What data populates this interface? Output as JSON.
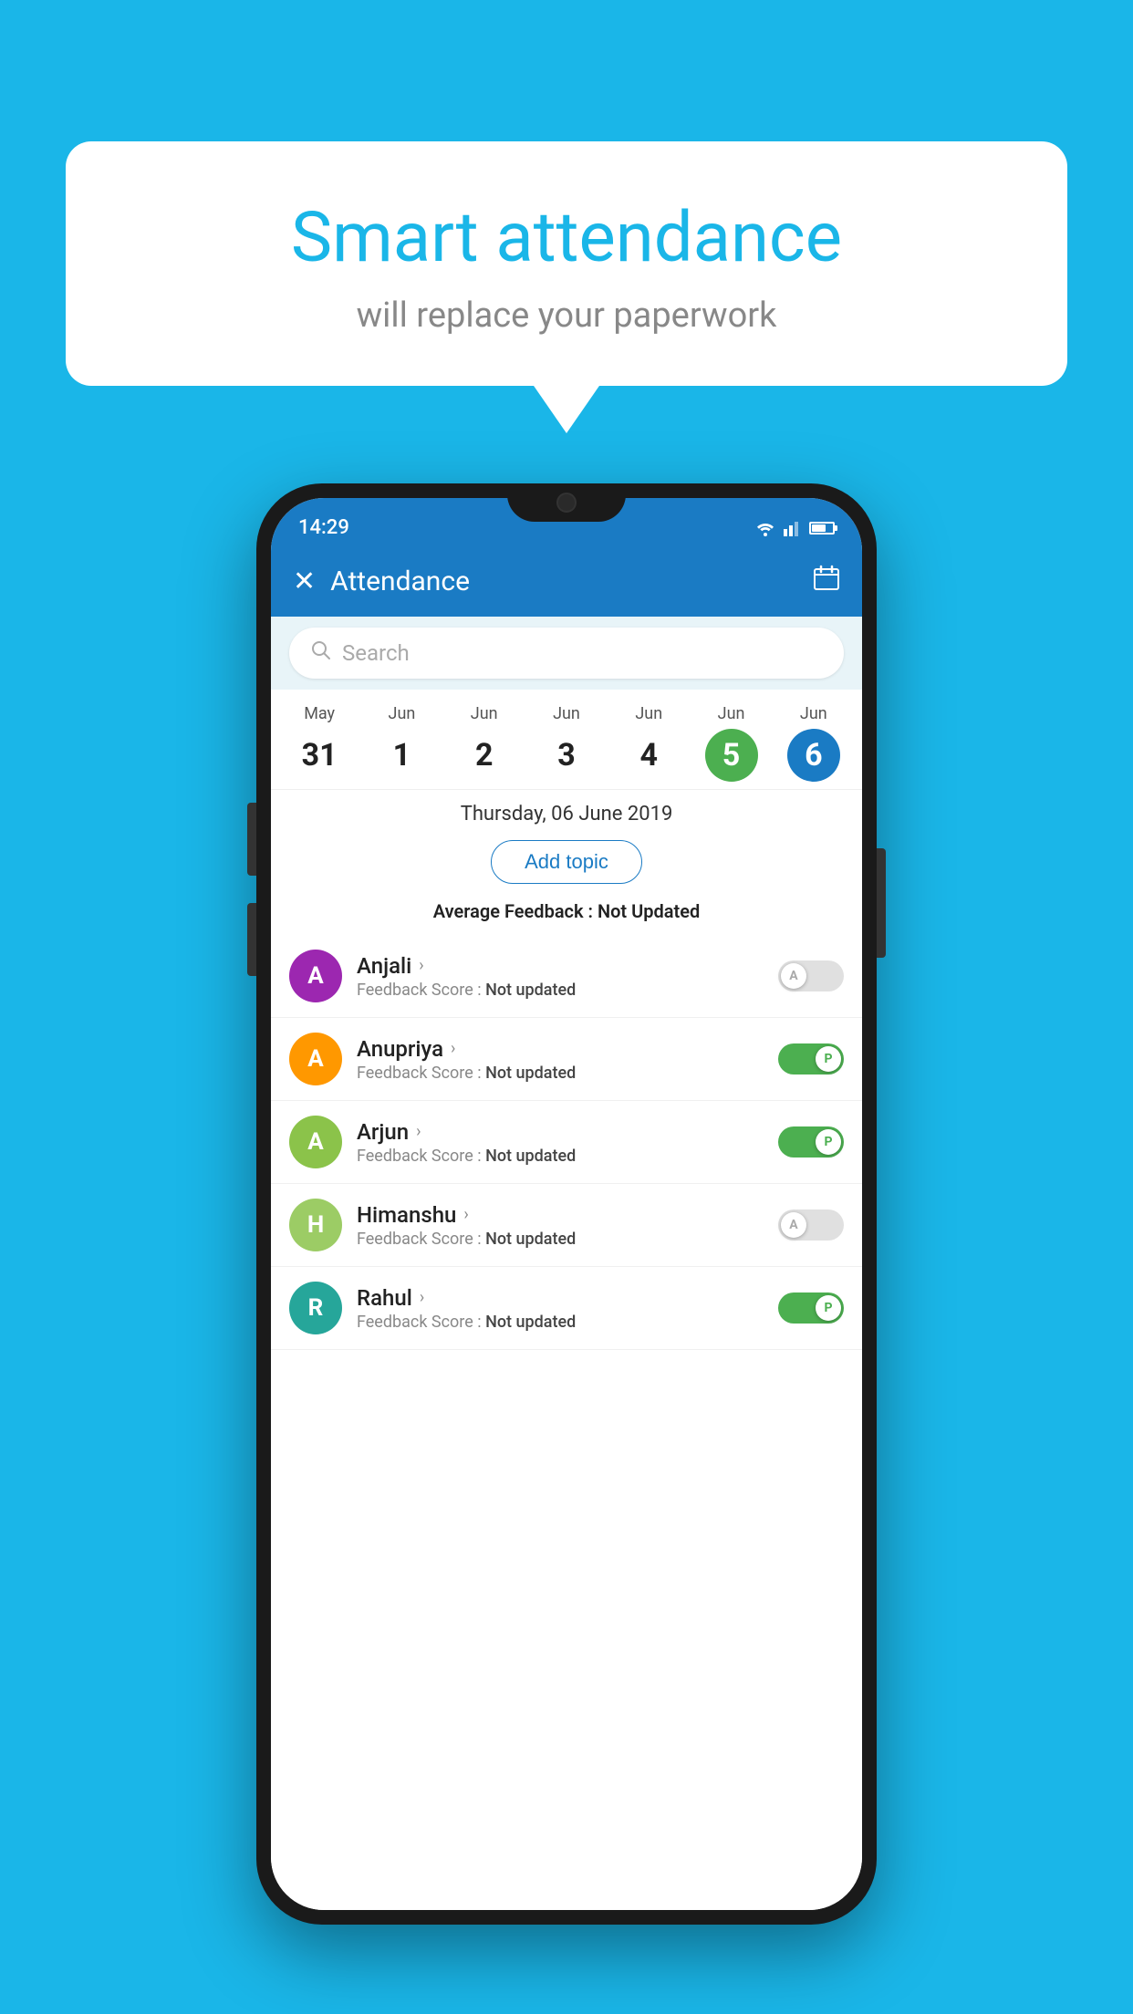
{
  "background_color": "#1ab6e8",
  "speech_bubble": {
    "title": "Smart attendance",
    "subtitle": "will replace your paperwork"
  },
  "status_bar": {
    "time": "14:29",
    "icons": [
      "wifi",
      "signal",
      "battery"
    ]
  },
  "app_bar": {
    "title": "Attendance",
    "close_label": "×",
    "calendar_icon": "📅"
  },
  "search": {
    "placeholder": "Search"
  },
  "calendar": {
    "days": [
      {
        "month": "May",
        "date": "31",
        "state": "normal"
      },
      {
        "month": "Jun",
        "date": "1",
        "state": "normal"
      },
      {
        "month": "Jun",
        "date": "2",
        "state": "normal"
      },
      {
        "month": "Jun",
        "date": "3",
        "state": "normal"
      },
      {
        "month": "Jun",
        "date": "4",
        "state": "normal"
      },
      {
        "month": "Jun",
        "date": "5",
        "state": "today"
      },
      {
        "month": "Jun",
        "date": "6",
        "state": "selected"
      }
    ],
    "selected_date_label": "Thursday, 06 June 2019"
  },
  "add_topic_label": "Add topic",
  "avg_feedback_label": "Average Feedback :",
  "avg_feedback_value": "Not Updated",
  "students": [
    {
      "name": "Anjali",
      "avatar_letter": "A",
      "avatar_color": "#9c27b0",
      "feedback_label": "Feedback Score :",
      "feedback_value": "Not updated",
      "toggle_state": "off",
      "toggle_letter": "A"
    },
    {
      "name": "Anupriya",
      "avatar_letter": "A",
      "avatar_color": "#ff9800",
      "feedback_label": "Feedback Score :",
      "feedback_value": "Not updated",
      "toggle_state": "on",
      "toggle_letter": "P"
    },
    {
      "name": "Arjun",
      "avatar_letter": "A",
      "avatar_color": "#8bc34a",
      "feedback_label": "Feedback Score :",
      "feedback_value": "Not updated",
      "toggle_state": "on",
      "toggle_letter": "P"
    },
    {
      "name": "Himanshu",
      "avatar_letter": "H",
      "avatar_color": "#9ccc65",
      "feedback_label": "Feedback Score :",
      "feedback_value": "Not updated",
      "toggle_state": "off",
      "toggle_letter": "A"
    },
    {
      "name": "Rahul",
      "avatar_letter": "R",
      "avatar_color": "#26a69a",
      "feedback_label": "Feedback Score :",
      "feedback_value": "Not updated",
      "toggle_state": "on",
      "toggle_letter": "P"
    }
  ]
}
